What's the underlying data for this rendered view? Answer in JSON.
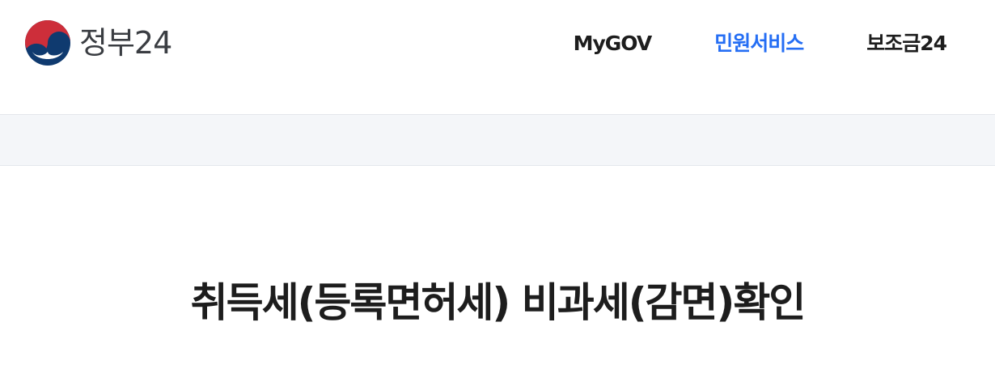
{
  "header": {
    "logo_text": "정부24",
    "colors": {
      "logo_red": "#cd2e3a",
      "logo_blue": "#0f3a6f",
      "nav_active": "#256ef4"
    },
    "nav": [
      {
        "label": "MyGOV",
        "active": false
      },
      {
        "label": "민원서비스",
        "active": true
      },
      {
        "label": "보조금24",
        "active": false
      }
    ]
  },
  "page": {
    "title": "취득세(등록면허세) 비과세(감면)확인"
  }
}
